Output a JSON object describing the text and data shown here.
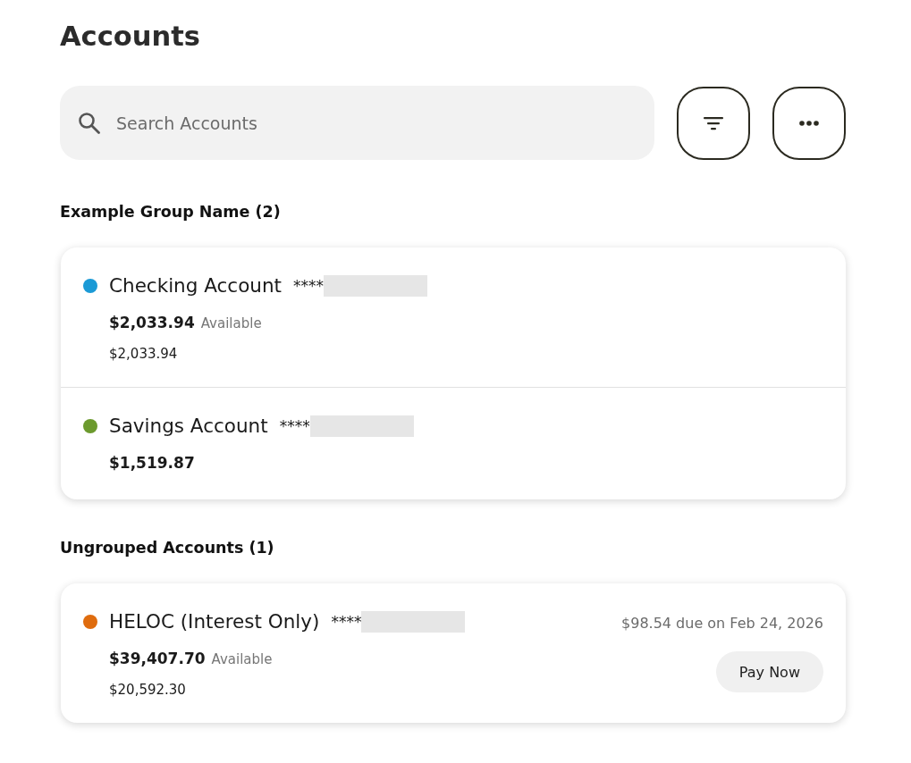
{
  "title": "Accounts",
  "search": {
    "placeholder": "Search Accounts"
  },
  "groups": [
    {
      "heading": "Example Group Name (2)",
      "accounts": [
        {
          "name": "Checking Account",
          "mask": "****",
          "color": "#1b9ad6",
          "balance": "$2,033.94",
          "balance_label": "Available",
          "secondary_balance": "$2,033.94"
        },
        {
          "name": "Savings Account",
          "mask": "****",
          "color": "#6c9a2e",
          "balance": "$1,519.87"
        }
      ]
    },
    {
      "heading": "Ungrouped Accounts (1)",
      "accounts": [
        {
          "name": "HELOC (Interest Only)",
          "mask": "****",
          "color": "#df6c0e",
          "balance": "$39,407.70",
          "balance_label": "Available",
          "secondary_balance": "$20,592.30",
          "due_text": "$98.54 due on Feb 24, 2026",
          "action": "Pay Now"
        }
      ]
    }
  ]
}
